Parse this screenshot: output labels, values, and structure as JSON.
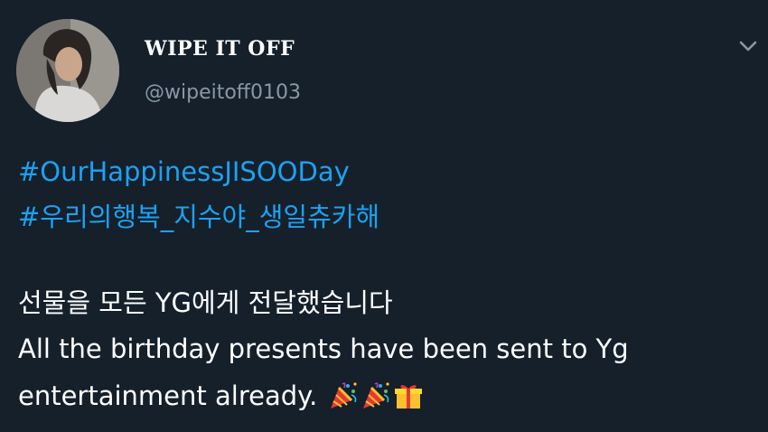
{
  "tweet": {
    "display_name": "WIPE IT OFF",
    "handle": "@wipeitoff0103",
    "hashtags": [
      "#OurHappinessJISOODay",
      "#우리의행복_지수야_생일츄카해"
    ],
    "text_korean": "선물을 모든 YG에게 전달했습니다",
    "text_english_line1": "All the birthday presents have been sent to Yg",
    "text_english_line2": "entertainment already.",
    "emojis": [
      "party-popper-icon",
      "party-popper-icon",
      "gift-icon"
    ]
  },
  "colors": {
    "background": "#15202b",
    "hashtag": "#1da1f2",
    "secondary_text": "#8899a6",
    "primary_text": "#ffffff"
  }
}
